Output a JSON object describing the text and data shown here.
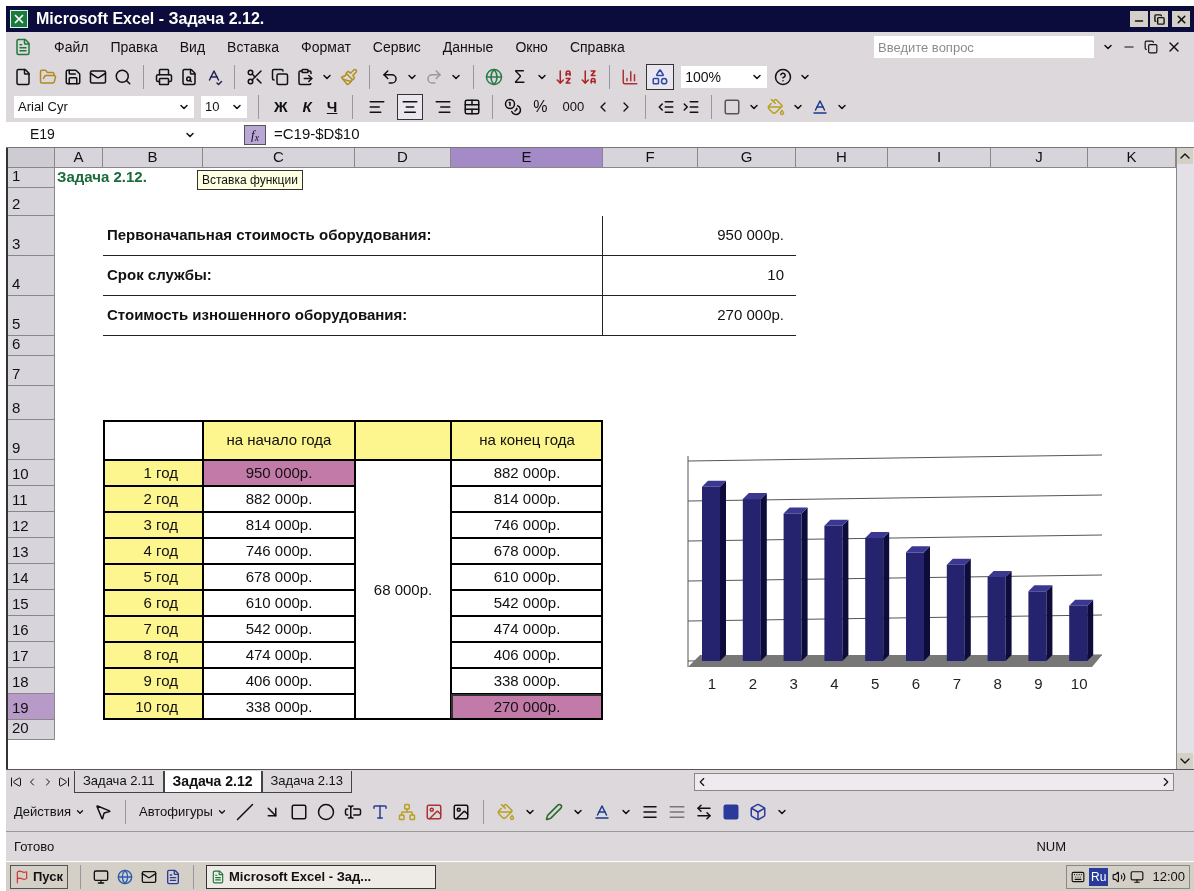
{
  "window": {
    "title": "Microsoft Excel - Задача 2.12."
  },
  "menu": [
    "Файл",
    "Правка",
    "Вид",
    "Вставка",
    "Формат",
    "Сервис",
    "Данные",
    "Окно",
    "Справка"
  ],
  "help_search": {
    "placeholder": "Введите вопрос"
  },
  "standard_toolbar": {
    "autosum": "Σ",
    "drawing_on": true,
    "zoom": "100%"
  },
  "formatting_toolbar": {
    "font": "Arial Cyr",
    "size": "10",
    "bold": "Ж",
    "italic": "К",
    "underline": "Ч",
    "alignment": [
      {
        "kind": "left",
        "selected": false
      },
      {
        "kind": "center",
        "selected": true
      },
      {
        "kind": "right",
        "selected": false
      }
    ],
    "percent": "%",
    "thousands": "000"
  },
  "formula_bar": {
    "name_box": "E19",
    "fx": "f$_{x}$",
    "formula": "=C19-$D$10"
  },
  "tooltip": "Вставка функции",
  "columns": [
    {
      "label": "A",
      "selected": false
    },
    {
      "label": "B",
      "selected": false
    },
    {
      "label": "C",
      "selected": false
    },
    {
      "label": "D",
      "selected": false
    },
    {
      "label": "E",
      "selected": true
    },
    {
      "label": "F",
      "selected": false
    },
    {
      "label": "G",
      "selected": false
    },
    {
      "label": "H",
      "selected": false
    },
    {
      "label": "I",
      "selected": false
    },
    {
      "label": "J",
      "selected": false
    },
    {
      "label": "K",
      "selected": false
    }
  ],
  "rows": [
    {
      "label": "1",
      "selected": false
    },
    {
      "label": "2",
      "selected": false
    },
    {
      "label": "3",
      "selected": false
    },
    {
      "label": "4",
      "selected": false
    },
    {
      "label": "5",
      "selected": false
    },
    {
      "label": "6",
      "selected": false
    },
    {
      "label": "7",
      "selected": false
    },
    {
      "label": "8",
      "selected": false
    },
    {
      "label": "9",
      "selected": false
    },
    {
      "label": "10",
      "selected": false
    },
    {
      "label": "11",
      "selected": false
    },
    {
      "label": "12",
      "selected": false
    },
    {
      "label": "13",
      "selected": false
    },
    {
      "label": "14",
      "selected": false
    },
    {
      "label": "15",
      "selected": false
    },
    {
      "label": "16",
      "selected": false
    },
    {
      "label": "17",
      "selected": false
    },
    {
      "label": "18",
      "selected": false
    },
    {
      "label": "19",
      "selected": true
    },
    {
      "label": "20",
      "selected": false
    }
  ],
  "sheet": {
    "title": "Задача 2.12.",
    "summary": [
      {
        "label": "Первоначапьная стоимость оборудования:",
        "value": "950 000р."
      },
      {
        "label": "Срок службы:",
        "value": "10"
      },
      {
        "label": "Стоимость изношенного оборудования:",
        "value": "270 000р."
      }
    ],
    "table": {
      "start_header": "на начало года",
      "end_header": "на конец года",
      "depreciation": "68 000р.",
      "rows": [
        {
          "year": "1 год",
          "start": "950 000р.",
          "start_selected": true,
          "end": "882 000р.",
          "end_selected": false
        },
        {
          "year": "2 год",
          "start": "882 000р.",
          "start_selected": false,
          "end": "814 000р.",
          "end_selected": false
        },
        {
          "year": "3 год",
          "start": "814 000р.",
          "start_selected": false,
          "end": "746 000р.",
          "end_selected": false
        },
        {
          "year": "4 год",
          "start": "746 000р.",
          "start_selected": false,
          "end": "678 000р.",
          "end_selected": false
        },
        {
          "year": "5 год",
          "start": "678 000р.",
          "start_selected": false,
          "end": "610 000р.",
          "end_selected": false
        },
        {
          "year": "6 год",
          "start": "610 000р.",
          "start_selected": false,
          "end": "542 000р.",
          "end_selected": false
        },
        {
          "year": "7 год",
          "start": "542 000р.",
          "start_selected": false,
          "end": "474 000р.",
          "end_selected": false
        },
        {
          "year": "8 год",
          "start": "474 000р.",
          "start_selected": false,
          "end": "406 000р.",
          "end_selected": false
        },
        {
          "year": "9 год",
          "start": "406 000р.",
          "start_selected": false,
          "end": "338 000р.",
          "end_selected": false
        },
        {
          "year": "10 год",
          "start": "338 000р.",
          "start_selected": false,
          "end": "270 000р.",
          "end_selected": true
        }
      ]
    },
    "chart": {
      "category_labels": [
        "1",
        "2",
        "3",
        "4",
        "5",
        "6",
        "7",
        "8",
        "9",
        "10"
      ]
    }
  },
  "sheet_tabs": [
    {
      "label": "Задача 2.11",
      "selected": false
    },
    {
      "label": "Задача 2.12",
      "selected": true
    },
    {
      "label": "Задача 2.13",
      "selected": false
    }
  ],
  "drawing_toolbar": {
    "actions": "Действия",
    "autoshapes": "Автофигуры"
  },
  "status_bar": {
    "message": "Готово",
    "num_lock": "NUM"
  },
  "taskbar": {
    "start": "Пуск",
    "tasks": [
      {
        "label": "Microsoft Excel - Зад...",
        "selected": true
      }
    ],
    "language": "Ru",
    "clock": "12:00"
  }
}
